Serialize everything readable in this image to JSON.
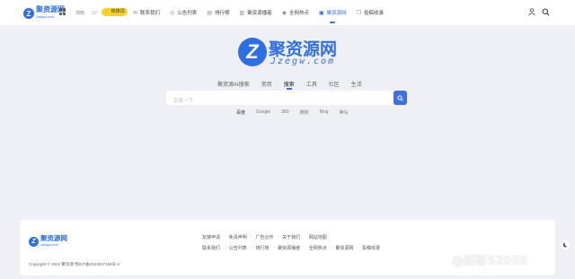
{
  "header": {
    "logo_name": "聚资源网",
    "logo_domain": "Jzegw.com",
    "weather_city": "渭南",
    "weather_temp": "10°",
    "hot_badge": "⚡ 热搜词",
    "nav": [
      {
        "icon": "✉",
        "label": "联系我们"
      },
      {
        "icon": "◎",
        "label": "公告列表"
      },
      {
        "icon": "▤",
        "label": "排行榜"
      },
      {
        "icon": "▥",
        "label": "聚资源播者"
      },
      {
        "icon": "◉",
        "label": "全网热点"
      },
      {
        "icon": "▣",
        "label": "聚资源网"
      },
      {
        "icon": "❐",
        "label": "投稿收录"
      }
    ]
  },
  "hero": {
    "logo_letter": "Z",
    "name": "聚资源网",
    "domain": "Jzegw.com"
  },
  "search": {
    "tabs": [
      "聚资源AI搜索",
      "常用",
      "搜索",
      "工具",
      "社区",
      "生活"
    ],
    "active_tab": "搜索",
    "placeholder": "百度一下",
    "engines": [
      "百度",
      "Google",
      "360",
      "搜狗",
      "Bing",
      "神马"
    ],
    "active_engine": "百度"
  },
  "footer": {
    "logo_name": "聚资源网",
    "logo_domain": "Jzegw.com",
    "copyright": "Copyright © 2024 聚资源 鄂ICP备2023007158号-2",
    "links_row1": [
      "友链申请",
      "免责声明",
      "广告合作",
      "关于我们",
      "网站地图"
    ],
    "links_row2": [
      "联系我们",
      "公告列表",
      "排行榜",
      "聚资源播者",
      "全网热点",
      "聚资源网",
      "投稿收录"
    ]
  },
  "watermark": "@朗哥52058",
  "colors": {
    "accent": "#2f6fe4",
    "background": "#eef0f5",
    "badge": "#f6d32d"
  }
}
